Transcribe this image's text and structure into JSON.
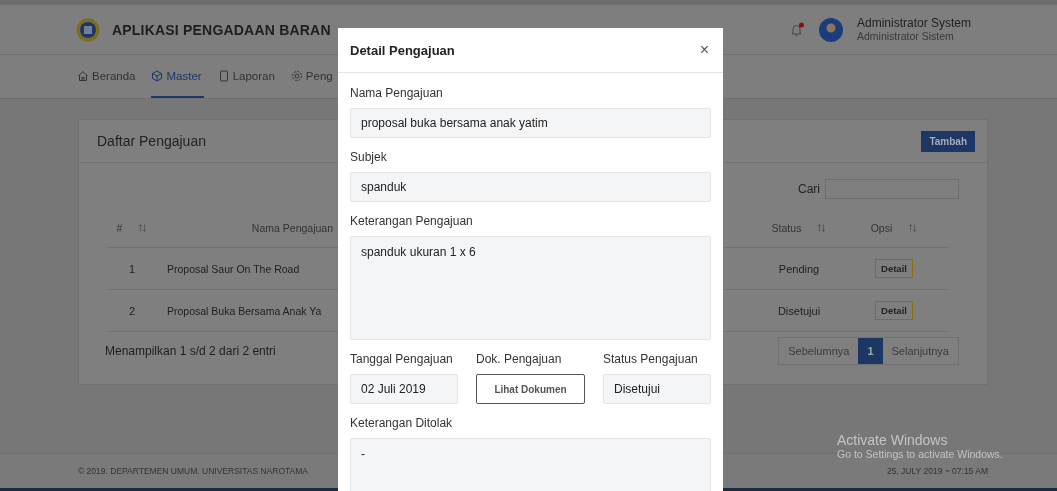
{
  "header": {
    "title": "APLIKASI PENGADAAN BARAN",
    "notification": {
      "unread": true
    },
    "user": {
      "name": "Administrator System",
      "role": "Administrator Sistem"
    }
  },
  "nav": [
    {
      "label": "Beranda",
      "selected": false
    },
    {
      "label": "Master",
      "selected": true
    },
    {
      "label": "Laporan",
      "selected": false
    },
    {
      "label": "Peng",
      "selected": false
    }
  ],
  "card": {
    "title": "Daftar Pengajuan",
    "add_button": "Tambah",
    "search_label": "Cari",
    "columns": [
      "#",
      "Nama Pengajuan",
      "Status",
      "Opsi"
    ],
    "rows": [
      {
        "number": "1",
        "name": "Proposal Saur On The Road",
        "status": "Pending",
        "action": "Detail"
      },
      {
        "number": "2",
        "name": "Proposal Buka Bersama Anak Ya",
        "status": "Disetujui",
        "action": "Detail"
      }
    ],
    "info": "Menampilkan 1 s/d 2 dari 2 entri",
    "pagination": {
      "prev": {
        "label": "Sebelumnya",
        "disabled": true
      },
      "pages": [
        {
          "label": "1",
          "selected": true
        }
      ],
      "next": {
        "label": "Selanjutnya",
        "disabled": true
      }
    }
  },
  "modal": {
    "title": "Detail Pengajuan",
    "close": "×",
    "fields": [
      {
        "label": "Nama Pengajuan",
        "value": "proposal buka bersama anak yatim",
        "kind": "input"
      },
      {
        "label": "Subjek",
        "value": "spanduk",
        "kind": "input"
      },
      {
        "label": "Keterangan Pengajuan",
        "value": "spanduk ukuran 1 x 6",
        "kind": "textarea"
      }
    ],
    "row_fields": [
      {
        "label": "Tanggal Pengajuan",
        "value": "02 Juli 2019",
        "kind": "input"
      },
      {
        "label": "Dok. Pengajuan",
        "value": "Lihat Dokumen",
        "kind": "button"
      },
      {
        "label": "Status Pengajuan",
        "value": "Disetujui",
        "kind": "input"
      }
    ],
    "bottom_fields": [
      {
        "label": "Keterangan Ditolak",
        "value": "-",
        "kind": "textarea"
      }
    ]
  },
  "footer": {
    "copyright": "© 2019. DEPARTEMEN UMUM. UNIVERSITAS NAROTAMA",
    "datetime": "25, JULY 2019 ~ 07:15 AM"
  },
  "os_notice": {
    "title": "Activate Windows",
    "subtitle": "Go to Settings to activate Windows."
  }
}
